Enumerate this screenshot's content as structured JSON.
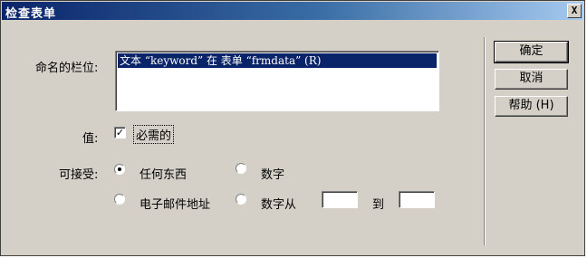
{
  "window": {
    "title": "检查表单",
    "close_glyph": "X"
  },
  "fields": {
    "column_label": "命名的栏位:",
    "list_items": [
      "文本 “keyword” 在 表单 “frmdata” (R)"
    ],
    "value_label": "值:",
    "required_checked": true,
    "required_label": "必需的",
    "accept_label": "可接受:",
    "accept_options": [
      {
        "label": "任何东西",
        "selected": true
      },
      {
        "label": "数字",
        "selected": false
      },
      {
        "label": "电子邮件地址",
        "selected": false
      },
      {
        "label": "数字从",
        "selected": false
      }
    ],
    "range_from": "",
    "range_to_label": "到",
    "range_to": ""
  },
  "buttons": {
    "ok": "确定",
    "cancel": "取消",
    "help": "帮助 (H)"
  },
  "colors": {
    "titlebar_start": "#0a246a",
    "titlebar_end": "#a6caf0",
    "dialog_face": "#d4d0c8",
    "selection": "#0a246a"
  }
}
